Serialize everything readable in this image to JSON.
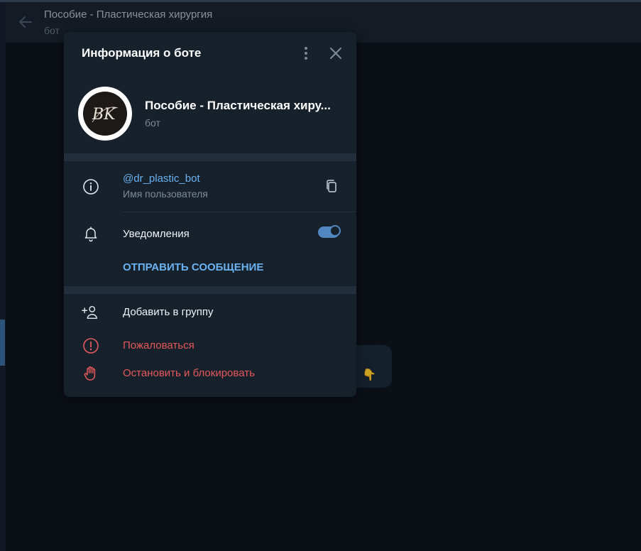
{
  "chat": {
    "title": "Пособие - Пластическая хирургия",
    "subtitle": "бот"
  },
  "bot_info": {
    "title": "Информация о боте",
    "name": "Пособие - Пластическая хиру...",
    "status": "бот",
    "avatar_monogram": "BK",
    "username": "@dr_plastic_bot",
    "username_label": "Имя пользователя",
    "notifications_label": "Уведомления",
    "notifications_enabled": true,
    "send_message_label": "ОТПРАВИТЬ СООБЩЕНИЕ",
    "add_to_group_label": "Добавить в группу",
    "report_label": "Пожаловаться",
    "block_label": "Остановить и блокировать"
  },
  "icons": {
    "back": "arrow-left-icon",
    "menu": "more-vertical-icon",
    "close": "close-icon",
    "info": "info-icon",
    "copy": "copy-icon",
    "bell": "bell-icon",
    "add_user": "add-user-icon",
    "report": "warning-circle-icon",
    "block": "hand-stop-icon"
  },
  "colors": {
    "accent": "#5288c1",
    "link": "#6ab2f2",
    "danger": "#e5585b",
    "panel": "#17212b",
    "background": "#0b1017"
  }
}
